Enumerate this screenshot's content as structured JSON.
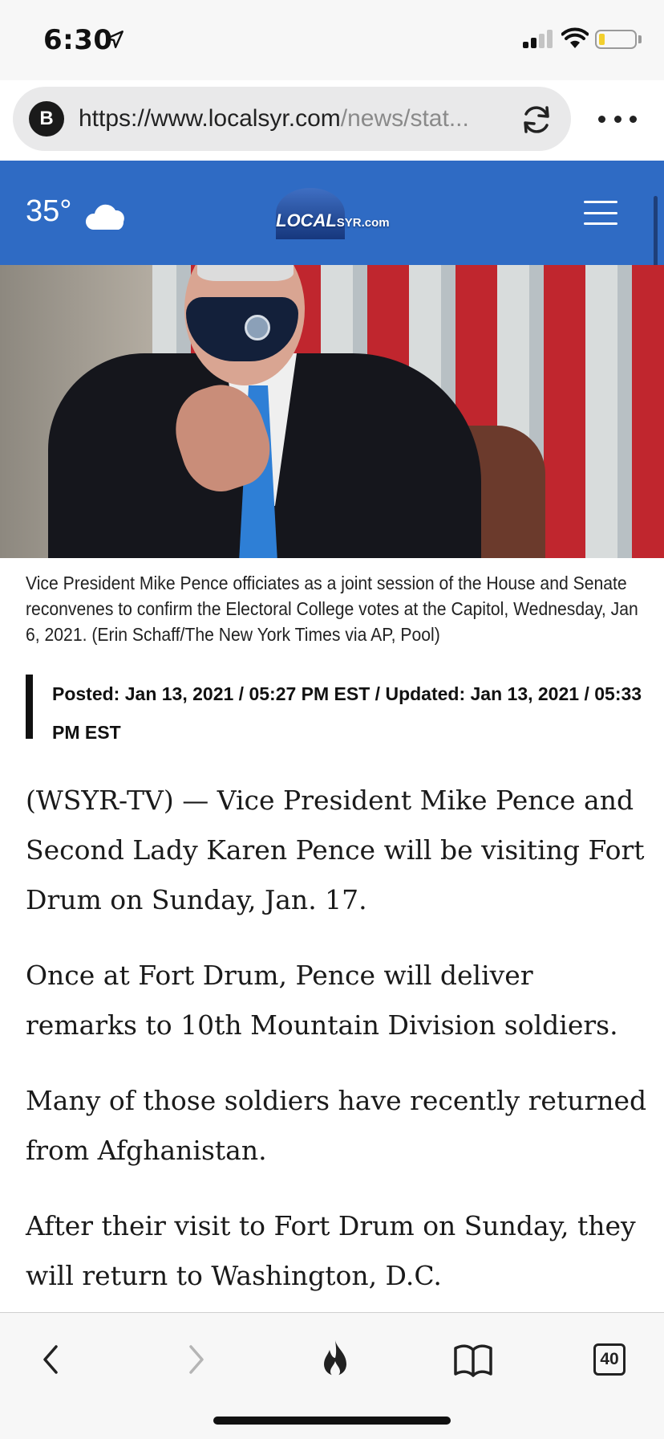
{
  "status_bar": {
    "time": "6:30",
    "icons": [
      "location-arrow-icon",
      "cellular-signal-icon",
      "wifi-icon",
      "battery-icon"
    ]
  },
  "browser": {
    "badge": "B",
    "url_host": "https://www.localsyr.com",
    "url_path": "/news/stat...",
    "icons": [
      "reload-icon",
      "more-icon"
    ]
  },
  "site_header": {
    "temperature": "35°",
    "weather_icon": "cloud-moon-icon",
    "logo_text": "LOCAL",
    "logo_suffix": "SYR.com",
    "menu_icon": "hamburger-icon",
    "brand_color": "#2f6bc4"
  },
  "article": {
    "caption": "Vice President Mike Pence officiates as a joint session of the House and Senate reconvenes to confirm the Electoral College votes at the Capitol, Wednesday, Jan 6, 2021. (Erin Schaff/The New York Times via AP, Pool)",
    "posted": "Posted: Jan 13, 2021 / 05:27 PM EST / Updated: Jan 13, 2021 / 05:33 PM EST",
    "paragraphs": [
      "(WSYR-TV) — Vice President Mike Pence and Second Lady Karen Pence will be visiting Fort Drum on Sunday, Jan. 17.",
      "Once at Fort Drum, Pence will deliver remarks to 10th Mountain Division soldiers.",
      "Many of those soldiers have recently returned from Afghanistan.",
      "After their visit to Fort Drum on Sunday, they will return to Washington, D.C."
    ]
  },
  "toolbar": {
    "tab_count": "40",
    "icons": [
      "back-icon",
      "forward-icon",
      "flame-icon",
      "bookmarks-icon",
      "tabs-icon"
    ]
  }
}
